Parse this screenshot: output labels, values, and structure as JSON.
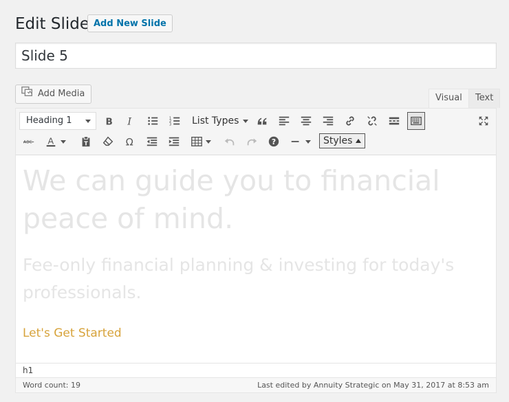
{
  "header": {
    "title": "Edit Slide",
    "add_new_label": "Add New Slide"
  },
  "slide_title": {
    "value": "Slide 5"
  },
  "media": {
    "add_media_label": "Add Media"
  },
  "tabs": [
    {
      "label": "Visual",
      "active": true
    },
    {
      "label": "Text",
      "active": false
    }
  ],
  "toolbar": {
    "format_value": "Heading 1",
    "list_types_label": "List Types",
    "styles_label": "Styles",
    "row1_icons": [
      "bold-icon",
      "italic-icon",
      "bullet-list-icon",
      "numbered-list-icon",
      "blockquote-icon",
      "align-left-icon",
      "align-center-icon",
      "align-right-icon",
      "link-icon",
      "unlink-icon",
      "read-more-icon",
      "toolbar-toggle-icon",
      "fullscreen-icon"
    ],
    "row2_icons": [
      "strikethrough-icon",
      "text-color-icon",
      "paste-text-icon",
      "clear-formatting-icon",
      "special-character-icon",
      "outdent-icon",
      "indent-icon",
      "table-icon",
      "undo-icon",
      "redo-icon",
      "help-icon",
      "horizontal-line-icon"
    ]
  },
  "content": {
    "heading": "We can guide you to financial peace of mind.",
    "subheading": "Fee-only financial planning & investing for today's professionals.",
    "cta": "Let's Get Started"
  },
  "status": {
    "path": "h1",
    "word_count": "Word count: 19",
    "last_edited": "Last edited by Annuity Strategic on May 31, 2017 at 8:53 am"
  },
  "colors": {
    "accent_link": "#0073aa",
    "cta_color": "#d7a33b",
    "faded_text": "#e5e5e5"
  }
}
